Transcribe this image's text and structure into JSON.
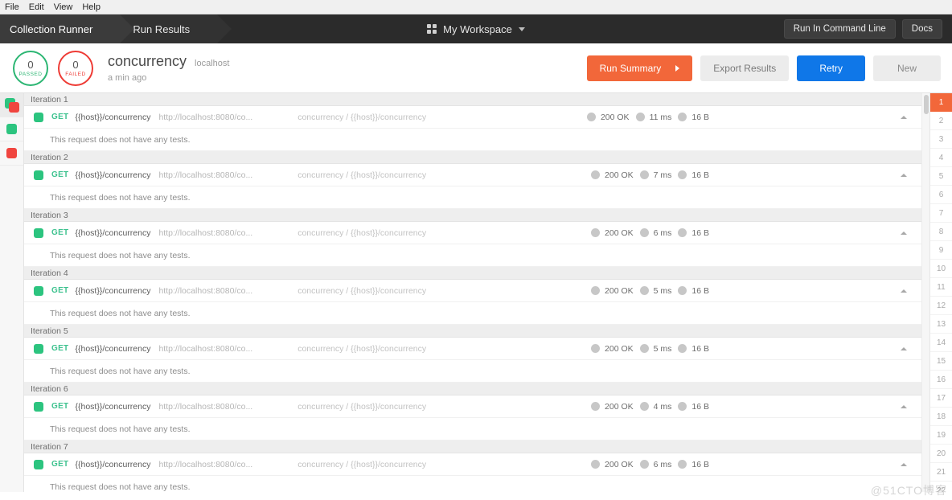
{
  "menubar": {
    "items": [
      "File",
      "Edit",
      "View",
      "Help"
    ]
  },
  "header": {
    "tabs": [
      {
        "label": "Collection Runner",
        "active": true
      },
      {
        "label": "Run Results",
        "active": false
      }
    ],
    "workspace": {
      "icon": "grid-icon",
      "label": "My Workspace",
      "caret": "chevron-down-icon"
    },
    "buttons": [
      {
        "label": "Run In Command Line",
        "name": "run-in-command-line-button"
      },
      {
        "label": "Docs",
        "name": "docs-button"
      }
    ]
  },
  "summary": {
    "passed": {
      "count": "0",
      "label": "PASSED",
      "color": "#2cb673"
    },
    "failed": {
      "count": "0",
      "label": "FAILED",
      "color": "#ee3b35"
    },
    "run_name": "concurrency",
    "environment": "localhost",
    "timestamp": "a min ago",
    "actions": {
      "run_summary": "Run Summary",
      "export_results": "Export Results",
      "retry": "Retry",
      "new": "New"
    },
    "colors": {
      "orange": "#f2673a",
      "blue": "#0f77e8",
      "grey": "#ececec"
    }
  },
  "filter_rail": [
    {
      "name": "filter-all",
      "icon": "stacked-squares-icon",
      "selected": true
    },
    {
      "name": "filter-passed",
      "icon": "green-square-icon",
      "selected": false
    },
    {
      "name": "filter-failed",
      "icon": "red-square-icon",
      "selected": false
    }
  ],
  "request_defaults": {
    "method": "GET",
    "name": "{{host}}/concurrency",
    "url": "http://localhost:8080/co...",
    "path": "concurrency / {{host}}/concurrency",
    "status": "200 OK",
    "size": "16 B",
    "tests_message": "This request does not have any tests.",
    "collapse_icon": "chevron-up-icon"
  },
  "iterations": [
    {
      "label": "Iteration 1",
      "method": "GET",
      "name": "{{host}}/concurrency",
      "url": "http://localhost:8080/co...",
      "path": "concurrency / {{host}}/concurrency",
      "status": "200 OK",
      "time": "11 ms",
      "size": "16 B",
      "tests_message": "This request does not have any tests."
    },
    {
      "label": "Iteration 2",
      "method": "GET",
      "name": "{{host}}/concurrency",
      "url": "http://localhost:8080/co...",
      "path": "concurrency / {{host}}/concurrency",
      "status": "200 OK",
      "time": "7 ms",
      "size": "16 B",
      "tests_message": "This request does not have any tests."
    },
    {
      "label": "Iteration 3",
      "method": "GET",
      "name": "{{host}}/concurrency",
      "url": "http://localhost:8080/co...",
      "path": "concurrency / {{host}}/concurrency",
      "status": "200 OK",
      "time": "6 ms",
      "size": "16 B",
      "tests_message": "This request does not have any tests."
    },
    {
      "label": "Iteration 4",
      "method": "GET",
      "name": "{{host}}/concurrency",
      "url": "http://localhost:8080/co...",
      "path": "concurrency / {{host}}/concurrency",
      "status": "200 OK",
      "time": "5 ms",
      "size": "16 B",
      "tests_message": "This request does not have any tests."
    },
    {
      "label": "Iteration 5",
      "method": "GET",
      "name": "{{host}}/concurrency",
      "url": "http://localhost:8080/co...",
      "path": "concurrency / {{host}}/concurrency",
      "status": "200 OK",
      "time": "5 ms",
      "size": "16 B",
      "tests_message": "This request does not have any tests."
    },
    {
      "label": "Iteration 6",
      "method": "GET",
      "name": "{{host}}/concurrency",
      "url": "http://localhost:8080/co...",
      "path": "concurrency / {{host}}/concurrency",
      "status": "200 OK",
      "time": "4 ms",
      "size": "16 B",
      "tests_message": "This request does not have any tests."
    },
    {
      "label": "Iteration 7",
      "method": "GET",
      "name": "{{host}}/concurrency",
      "url": "http://localhost:8080/co...",
      "path": "concurrency / {{host}}/concurrency",
      "status": "200 OK",
      "time": "6 ms",
      "size": "16 B",
      "tests_message": "This request does not have any tests."
    }
  ],
  "iteration_index": {
    "active": "1",
    "items": [
      "1",
      "2",
      "3",
      "4",
      "5",
      "6",
      "7",
      "8",
      "9",
      "10",
      "11",
      "12",
      "13",
      "14",
      "15",
      "16",
      "17",
      "18",
      "19",
      "20",
      "21",
      "22"
    ]
  },
  "watermark": "@51CTO博客"
}
